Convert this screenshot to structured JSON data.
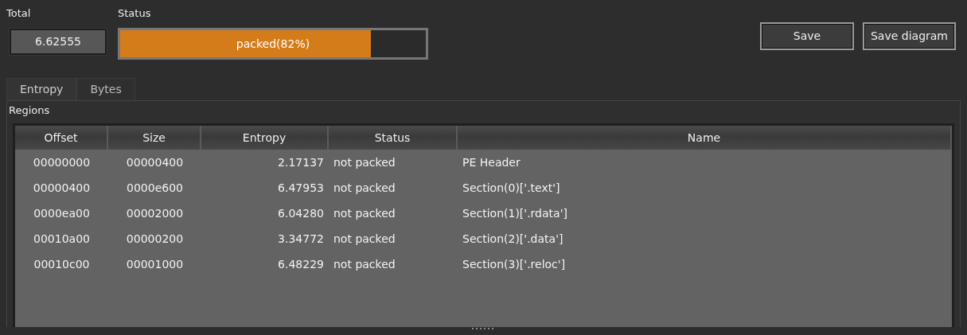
{
  "total": {
    "label": "Total",
    "value": "6.62555"
  },
  "status": {
    "label": "Status",
    "text": "packed(82%)",
    "level": 0.82
  },
  "buttons": [
    "Save",
    "Save diagram"
  ],
  "tabs": [
    {
      "label": "Entropy",
      "selected": true
    },
    {
      "label": "Bytes",
      "selected": false
    }
  ],
  "regions": {
    "title": "Regions",
    "columns": [
      "Offset",
      "Size",
      "Entropy",
      "Status",
      "Name"
    ],
    "rows": [
      [
        "00000000",
        "00000400",
        "2.17137",
        "not packed",
        "PE Header"
      ],
      [
        "00000400",
        "0000e600",
        "6.47953",
        "not packed",
        "Section(0)['.text']"
      ],
      [
        "0000ea00",
        "00002000",
        "6.04280",
        "not packed",
        "Section(1)['.rdata']"
      ],
      [
        "00010a00",
        "00000200",
        "3.34772",
        "not packed",
        "Section(2)['.data']"
      ],
      [
        "00010c00",
        "00001000",
        "6.48229",
        "not packed",
        "Section(3)['.reloc']"
      ]
    ]
  }
}
